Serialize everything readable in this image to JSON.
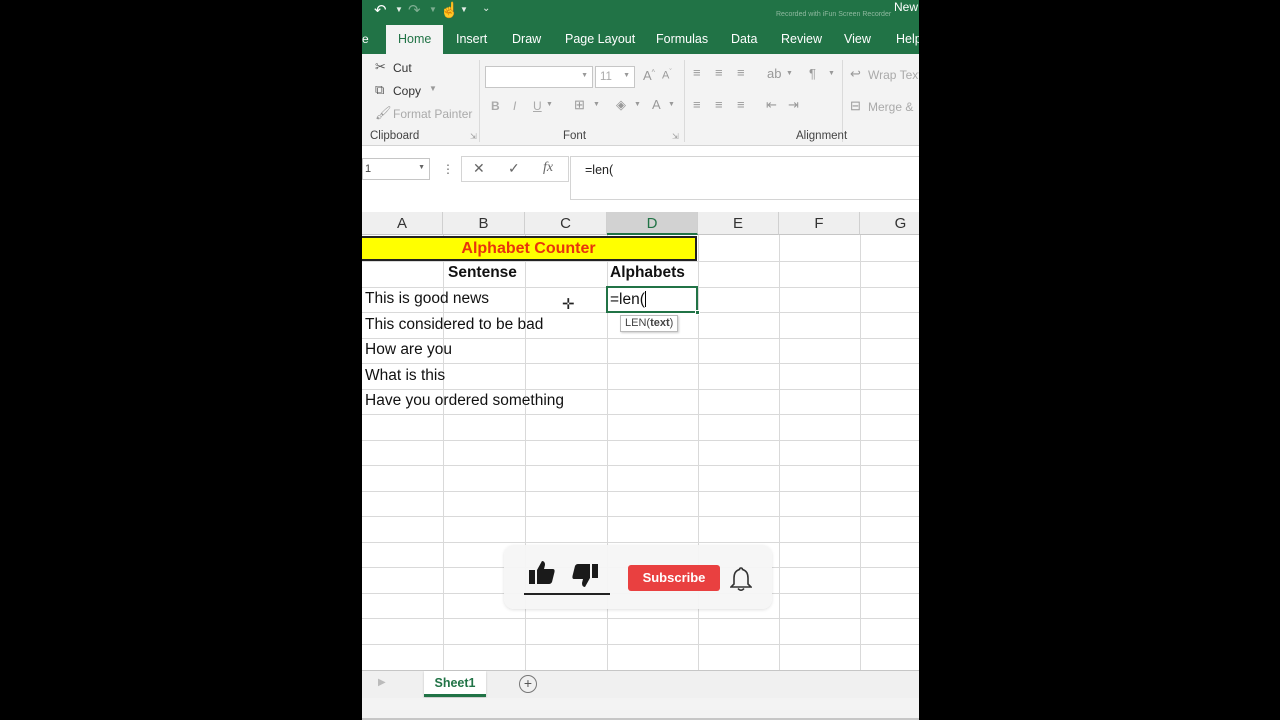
{
  "app": {
    "doc_title": "New",
    "watermark": "Recorded with iFun Screen Recorder"
  },
  "tabs": [
    {
      "label": "Home",
      "active": true
    },
    {
      "label": "Insert"
    },
    {
      "label": "Draw"
    },
    {
      "label": "Page Layout"
    },
    {
      "label": "Formulas"
    },
    {
      "label": "Data"
    },
    {
      "label": "Review"
    },
    {
      "label": "View"
    },
    {
      "label": "Help"
    }
  ],
  "ribbon": {
    "clipboard": {
      "cut": "Cut",
      "copy": "Copy",
      "format_painter": "Format Painter",
      "label": "Clipboard"
    },
    "font": {
      "font_size": "11",
      "bold": "B",
      "italic": "I",
      "underline": "U",
      "label": "Font"
    },
    "alignment": {
      "wrap_text": "Wrap Text",
      "merge": "Merge &",
      "label": "Alignment"
    }
  },
  "formula_bar": {
    "name_box": "1",
    "cancel_icon": "✕",
    "enter_icon": "✓",
    "fx_label": "fx",
    "value": "=len("
  },
  "columns": [
    "A",
    "B",
    "C",
    "D",
    "E",
    "F",
    "G"
  ],
  "selected_column": "D",
  "sheet": {
    "banner": "Alphabet Counter",
    "header_sentence": "Sentense",
    "header_alphabets": "Alphabets",
    "rows": [
      "This is good news",
      "This considered to be bad",
      "How are you",
      "What is this",
      "Have you ordered something"
    ],
    "active_cell_value": "=len(",
    "tooltip_fn": "LEN(",
    "tooltip_arg": "text",
    "tooltip_close": ")"
  },
  "sheet_tabs": {
    "tab": "Sheet1",
    "add": "+"
  },
  "overlay": {
    "subscribe": "Subscribe",
    "accent": "#e94040"
  },
  "colors": {
    "excel_green": "#217346",
    "banner_fill": "#ffff00",
    "banner_text": "#e8340c"
  }
}
